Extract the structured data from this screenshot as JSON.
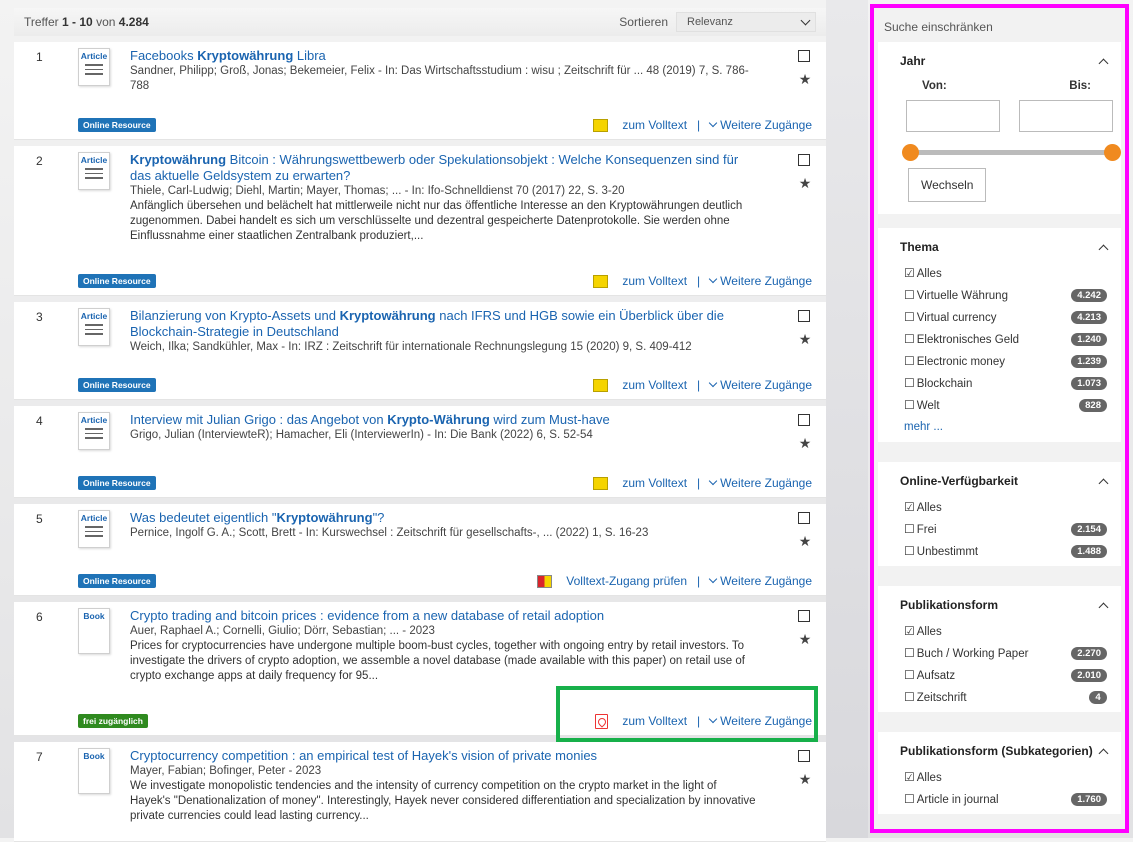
{
  "results_header": {
    "count_prefix": "Treffer",
    "range": "1 - 10",
    "von": "von",
    "total": "4.284",
    "sort_label": "Sortieren",
    "sort_value": "Relevanz"
  },
  "common": {
    "volltext": "zum Volltext",
    "separator": "|",
    "weitere": "Weitere Zugänge",
    "online": "Online Resource",
    "free": "frei zugänglich",
    "pruefen": "Volltext-Zugang prüfen"
  },
  "results": [
    {
      "num": "1",
      "type": "Article",
      "title_pre": "Facebooks ",
      "title_bold": "Kryptowährung",
      "title_post": " Libra",
      "meta": "Sandner, Philipp; Groß, Jonas; Bekemeier, Felix - In: Das Wirtschaftsstudium : wisu ; Zeitschrift für ... 48 (2019) 7, S. 786-788"
    },
    {
      "num": "2",
      "type": "Article",
      "title_pre": "",
      "title_bold": "Kryptowährung",
      "title_post": " Bitcoin : Währungswettbewerb oder Spekulationsobjekt : Welche Konsequenzen sind für das aktuelle Geldsystem zu erwarten?",
      "meta": "Thiele, Carl-Ludwig; Diehl, Martin; Mayer, Thomas; ... - In: Ifo-Schnelldienst 70 (2017) 22, S. 3-20",
      "abstract": "Anfänglich übersehen und belächelt hat mittlerweile nicht nur das öffentliche Interesse an den Kryptowährungen deutlich zugenommen. Dabei handelt es sich um verschlüsselte und dezentral gespeicherte Datenprotokolle. Sie werden ohne Einflussnahme einer staatlichen Zentralbank produziert,..."
    },
    {
      "num": "3",
      "type": "Article",
      "title_pre": "Bilanzierung von Krypto-Assets und ",
      "title_bold": "Kryptowährung",
      "title_post": " nach IFRS und HGB sowie ein Überblick über die Blockchain-Strategie in Deutschland",
      "meta": "Weich, Ilka; Sandkühler, Max - In: IRZ : Zeitschrift für internationale Rechnungslegung 15 (2020) 9, S. 409-412"
    },
    {
      "num": "4",
      "type": "Article",
      "title_pre": "Interview mit Julian Grigo : das Angebot von ",
      "title_bold": "Krypto-Währung",
      "title_post": " wird zum Must-have",
      "meta": "Grigo, Julian (InterviewteR); Hamacher, Eli (InterviewerIn) - In: Die Bank (2022) 6, S. 52-54"
    },
    {
      "num": "5",
      "type": "Article",
      "title_pre": "Was bedeutet eigentlich \"",
      "title_bold": "Kryptowährung",
      "title_post": "\"?",
      "meta": "Pernice, Ingolf G. A.; Scott, Brett - In: Kurswechsel : Zeitschrift für gesellschafts-, ... (2022) 1, S. 16-23"
    },
    {
      "num": "6",
      "type": "Book",
      "title_pre": "Crypto trading and bitcoin prices : evidence from a new database of retail adoption",
      "title_bold": "",
      "title_post": "",
      "meta": "Auer, Raphael A.; Cornelli, Giulio; Dörr, Sebastian; ... - 2023",
      "abstract": "Prices for cryptocurrencies have undergone multiple boom-bust cycles, together with ongoing entry by retail investors. To investigate the drivers of crypto adoption, we assemble a novel database (made available with this paper) on retail use of crypto exchange apps at daily frequency for 95..."
    },
    {
      "num": "7",
      "type": "Book",
      "title_pre": "Cryptocurrency competition : an empirical test of Hayek's vision of private monies",
      "title_bold": "",
      "title_post": "",
      "meta": "Mayer, Fabian; Bofinger, Peter - 2023",
      "abstract": "We investigate monopolistic tendencies and the intensity of currency competition on the crypto market in the light of Hayek's \"Denationalization of money\". Interestingly, Hayek never considered differentiation and specialization by innovative private currencies could lead lasting currency..."
    }
  ],
  "filters": {
    "head": "Suche einschränken",
    "jahr": {
      "title": "Jahr",
      "von": "Von:",
      "bis": "Bis:",
      "button": "Wechseln"
    },
    "thema": {
      "title": "Thema",
      "all": "Alles",
      "more": "mehr ...",
      "items": [
        {
          "label": "Virtuelle Währung",
          "count": "4.242"
        },
        {
          "label": "Virtual currency",
          "count": "4.213"
        },
        {
          "label": "Elektronisches Geld",
          "count": "1.240"
        },
        {
          "label": "Electronic money",
          "count": "1.239"
        },
        {
          "label": "Blockchain",
          "count": "1.073"
        },
        {
          "label": "Welt",
          "count": "828"
        }
      ]
    },
    "online": {
      "title": "Online-Verfügbarkeit",
      "all": "Alles",
      "items": [
        {
          "label": "Frei",
          "count": "2.154"
        },
        {
          "label": "Unbestimmt",
          "count": "1.488"
        }
      ]
    },
    "pubform": {
      "title": "Publikationsform",
      "all": "Alles",
      "items": [
        {
          "label": "Buch / Working Paper",
          "count": "2.270"
        },
        {
          "label": "Aufsatz",
          "count": "2.010"
        },
        {
          "label": "Zeitschrift",
          "count": "4"
        }
      ]
    },
    "pubsub": {
      "title": "Publikationsform (Subkategorien)",
      "all": "Alles",
      "items": [
        {
          "label": "Article in journal",
          "count": "1.760"
        }
      ]
    }
  }
}
